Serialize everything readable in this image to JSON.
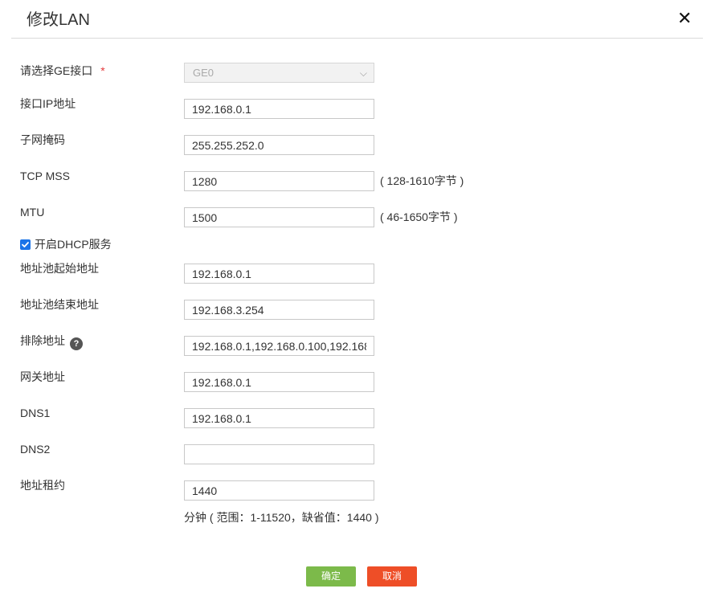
{
  "dialog": {
    "title": "修改LAN",
    "close_icon": "close-icon"
  },
  "form": {
    "ge_interface": {
      "label": "请选择GE接口",
      "required_mark": "*",
      "value": "GE0"
    },
    "ip": {
      "label": "接口IP地址",
      "value": "192.168.0.1"
    },
    "mask": {
      "label": "子网掩码",
      "value": "255.255.252.0"
    },
    "tcp_mss": {
      "label": "TCP MSS",
      "value": "1280",
      "hint": "( 128-1610字节 )"
    },
    "mtu": {
      "label": "MTU",
      "value": "1500",
      "hint": "( 46-1650字节 )"
    },
    "dhcp": {
      "label": "开启DHCP服务",
      "checked": true
    },
    "pool_start": {
      "label": "地址池起始地址",
      "value": "192.168.0.1"
    },
    "pool_end": {
      "label": "地址池结束地址",
      "value": "192.168.3.254"
    },
    "exclude": {
      "label": "排除地址",
      "help_icon": "?",
      "value": "192.168.0.1,192.168.0.100,192.168"
    },
    "gateway": {
      "label": "网关地址",
      "value": "192.168.0.1"
    },
    "dns1": {
      "label": "DNS1",
      "value": "192.168.0.1"
    },
    "dns2": {
      "label": "DNS2",
      "value": ""
    },
    "lease": {
      "label": "地址租约",
      "value": "1440",
      "note": "分钟 ( 范围：1-11520，缺省值：1440 )"
    }
  },
  "buttons": {
    "ok": "确定",
    "cancel": "取消"
  },
  "colors": {
    "ok": "#7cba4a",
    "cancel": "#ee4e27",
    "required": "#e4393c",
    "checkbox": "#1a73e8"
  }
}
